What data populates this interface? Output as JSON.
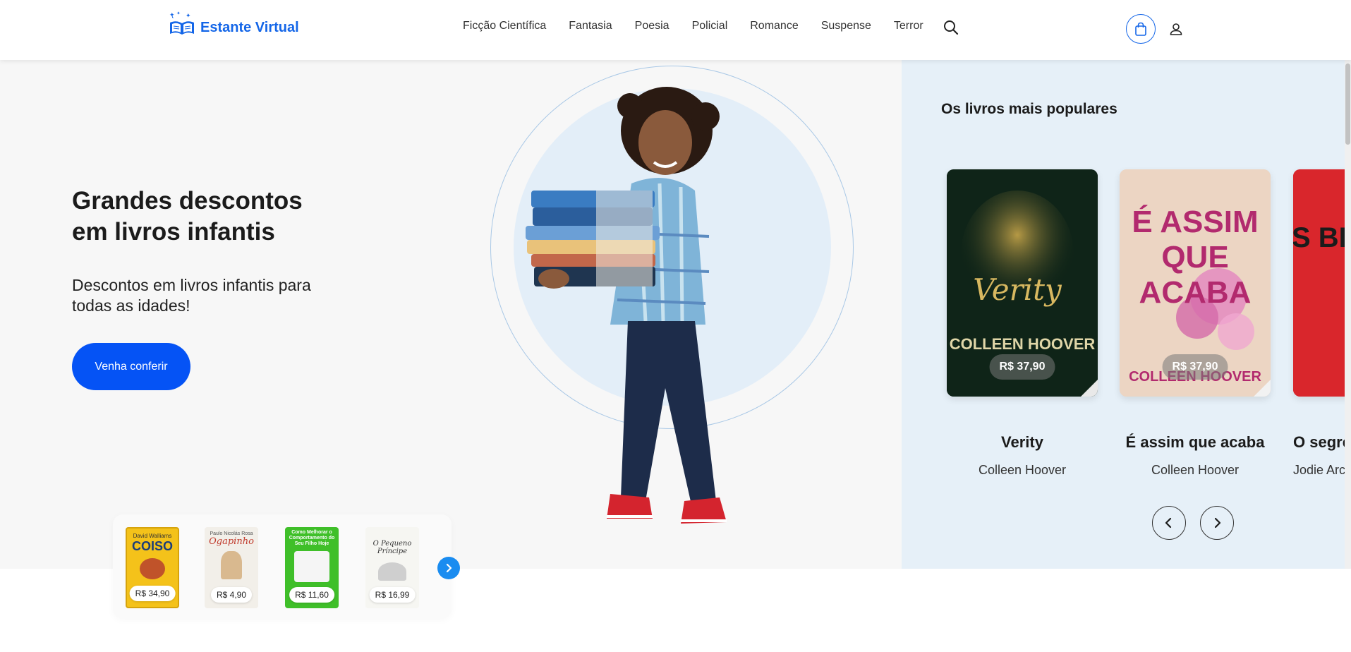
{
  "brand": {
    "name": "Estante Virtual",
    "accent": "#1466e8"
  },
  "nav": {
    "items": [
      "Ficção Científica",
      "Fantasia",
      "Poesia",
      "Policial",
      "Romance",
      "Suspense",
      "Terror"
    ],
    "icons": {
      "search": "search-icon",
      "bag": "shopping-bag-icon",
      "user": "user-icon"
    }
  },
  "hero": {
    "title": "Grandes descontos em livros infantis",
    "subtitle": "Descontos em livros infantis para todas as idades!",
    "cta_label": "Venha conferir",
    "cta_color": "#0553f5"
  },
  "mini_books": [
    {
      "price": "R$ 34,90",
      "cover_text": "COISO",
      "cover_author": "David Walliams",
      "color": "#f4c21a"
    },
    {
      "price": "R$ 4,90",
      "cover_text": "Ogapinho",
      "cover_author": "Paulo Nicolás Rosa",
      "color": "#f2efe9"
    },
    {
      "price": "R$ 11,60",
      "cover_text": "Como Melhorar o Comportamento do Seu Filho Hoje",
      "cover_author": "",
      "color": "#3fbf29"
    },
    {
      "price": "R$ 16,99",
      "cover_text": "O Pequeno Príncipe",
      "cover_author": "",
      "color": "#f6f6f2"
    }
  ],
  "popular": {
    "title": "Os livros mais populares",
    "books": [
      {
        "title": "Verity",
        "author": "Colleen Hoover",
        "price": "R$ 37,90",
        "cover_text": "Verity",
        "cover_author": "COLLEEN HOOVER"
      },
      {
        "title": "É assim que acaba",
        "author": "Colleen Hoover",
        "price": "R$ 37,90",
        "cover_text": "É ASSIM QUE ACABA",
        "cover_author": "COLLEEN HOOVER"
      },
      {
        "title": "O segre",
        "author": "Jodie Arc",
        "price": "",
        "cover_text": "S BES",
        "cover_author": ""
      }
    ]
  }
}
